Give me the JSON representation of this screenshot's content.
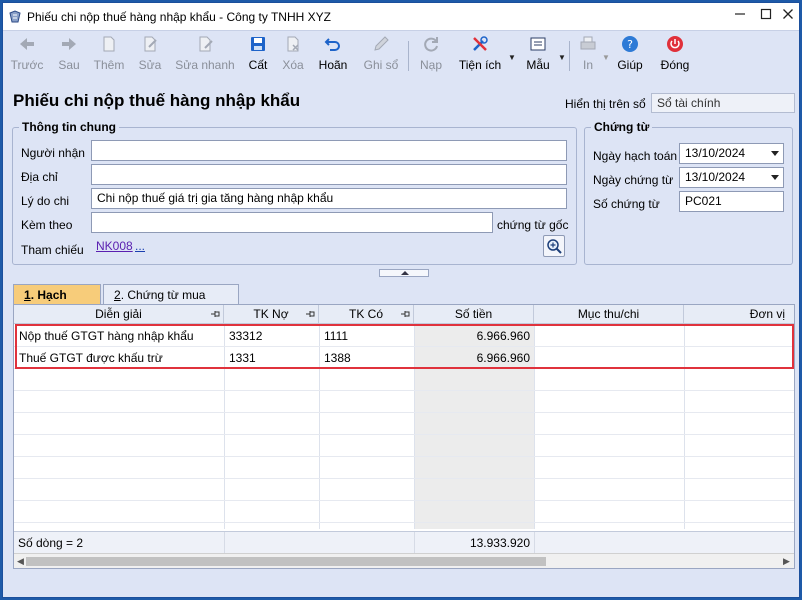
{
  "window": {
    "title": "Phiếu chi nộp thuế hàng nhập khẩu - Công ty TNHH XYZ",
    "minimize_icon": "minimize-icon",
    "maximize_icon": "maximize-icon",
    "close_icon": "close-icon"
  },
  "toolbar": {
    "items": [
      {
        "label": "Trước",
        "icon": "arrow-left-icon",
        "enabled": false
      },
      {
        "label": "Sau",
        "icon": "arrow-right-icon",
        "enabled": false
      },
      {
        "label": "Thêm",
        "icon": "new-document-icon",
        "enabled": false
      },
      {
        "label": "Sửa",
        "icon": "edit-document-icon",
        "enabled": false
      },
      {
        "label": "Sửa nhanh",
        "icon": "quick-edit-icon",
        "enabled": false
      },
      {
        "label": "Cất",
        "icon": "save-icon",
        "enabled": true
      },
      {
        "label": "Xóa",
        "icon": "delete-document-icon",
        "enabled": false
      },
      {
        "label": "Hoãn",
        "icon": "undo-icon",
        "enabled": true
      },
      {
        "label": "Ghi sổ",
        "icon": "pencil-icon",
        "enabled": false
      },
      {
        "label": "Nạp",
        "icon": "refresh-icon",
        "enabled": false
      },
      {
        "label": "Tiện ích",
        "icon": "tools-icon",
        "enabled": true
      },
      {
        "label": "Mẫu",
        "icon": "template-icon",
        "enabled": true
      },
      {
        "label": "In",
        "icon": "printer-icon",
        "enabled": false
      },
      {
        "label": "Giúp",
        "icon": "help-icon",
        "enabled": true
      },
      {
        "label": "Đóng",
        "icon": "power-icon",
        "enabled": true
      }
    ],
    "accent": "#1d63c9",
    "close_color": "#e0303a"
  },
  "header": {
    "title": "Phiếu chi nộp thuế hàng nhập khẩu",
    "display_label": "Hiển thị trên sổ",
    "display_value": "Sổ tài chính"
  },
  "general": {
    "legend": "Thông tin chung",
    "nguoi_nhan_label": "Người nhận",
    "nguoi_nhan_value": "",
    "dia_chi_label": "Địa chỉ",
    "dia_chi_value": "",
    "ly_do_label": "Lý do chi",
    "ly_do_value": "Chi nộp thuế giá trị gia tăng hàng nhập khẩu",
    "kem_theo_label": "Kèm theo",
    "kem_theo_value": "",
    "chung_tu_goc_label": "chứng từ gốc",
    "tham_chieu_label": "Tham chiếu",
    "tham_chieu_link": "NK008",
    "tham_chieu_more": "...",
    "zoom_icon": "zoom-in-icon"
  },
  "voucher": {
    "legend": "Chứng từ",
    "ngay_hach_toan_label": "Ngày hạch toán",
    "ngay_hach_toan_value": "13/10/2024",
    "ngay_chung_tu_label": "Ngày chứng từ",
    "ngay_chung_tu_value": "13/10/2024",
    "so_chung_tu_label": "Số chứng từ",
    "so_chung_tu_value": "PC021"
  },
  "tabs": [
    {
      "prefix": "1",
      "label": ". Hạch toán"
    },
    {
      "prefix": "2",
      "label": ". Chứng từ mua hàng"
    }
  ],
  "grid": {
    "columns": [
      "Diễn giải",
      "TK Nợ",
      "TK Có",
      "Số tiền",
      "Mục thu/chi",
      "Đơn vị"
    ],
    "rows": [
      {
        "dien_giai": "Nộp thuế GTGT hàng nhập khẩu",
        "tk_no": "33312",
        "tk_co": "1111",
        "so_tien": "6.966.960"
      },
      {
        "dien_giai": "Thuế GTGT được khấu trừ",
        "tk_no": "1331",
        "tk_co": "1388",
        "so_tien": "6.966.960"
      }
    ],
    "footer_count": "Số dòng = 2",
    "footer_total": "13.933.920",
    "highlight_color": "#e0323c"
  }
}
